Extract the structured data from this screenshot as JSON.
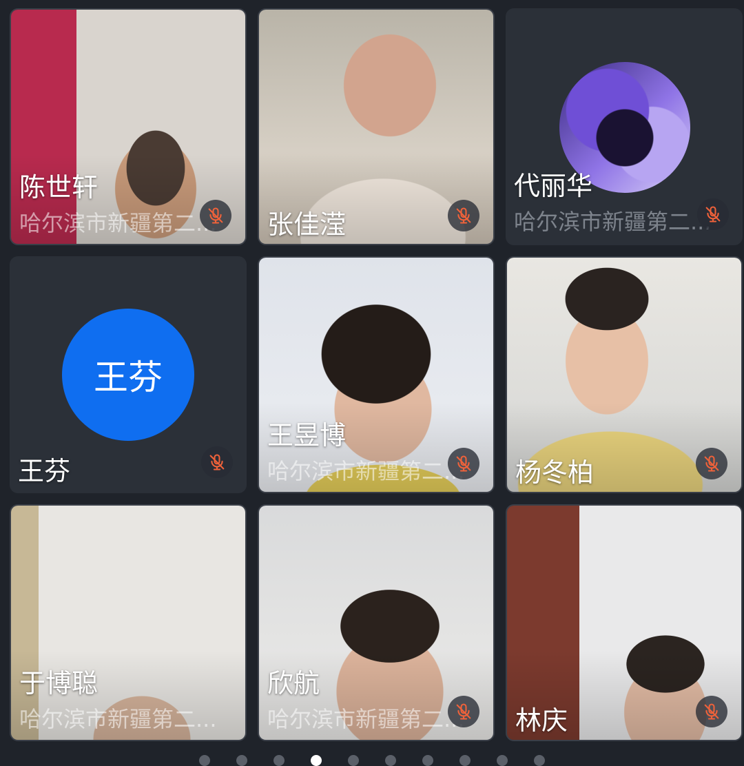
{
  "participants": [
    {
      "name": "陈世轩",
      "subtitle": "哈尔滨市新疆第二...",
      "muted": true,
      "view": "video"
    },
    {
      "name": "张佳滢",
      "subtitle": "",
      "muted": true,
      "view": "video"
    },
    {
      "name": "代丽华",
      "subtitle": "哈尔滨市新疆第二...",
      "muted": true,
      "view": "avatar-image",
      "avatar_icon": "anime-character-avatar"
    },
    {
      "name": "王芬",
      "subtitle": "",
      "muted": true,
      "view": "avatar-initials",
      "initials": "王芬",
      "avatar_color": "#0f6ef0"
    },
    {
      "name": "王昱博",
      "subtitle": "哈尔滨市新疆第二...",
      "muted": true,
      "view": "video"
    },
    {
      "name": "杨冬柏",
      "subtitle": "",
      "muted": true,
      "view": "video"
    },
    {
      "name": "于博聪",
      "subtitle": "哈尔滨市新疆第二...",
      "muted": true,
      "view": "video"
    },
    {
      "name": "欣航",
      "subtitle": "哈尔滨市新疆第二...",
      "muted": true,
      "view": "video"
    },
    {
      "name": "林庆",
      "subtitle": "",
      "muted": true,
      "view": "video"
    }
  ],
  "mic_icon": "mic-muted-icon",
  "mic_icon_color": "#f0623a",
  "pager": {
    "total": 10,
    "active_index": 3
  }
}
